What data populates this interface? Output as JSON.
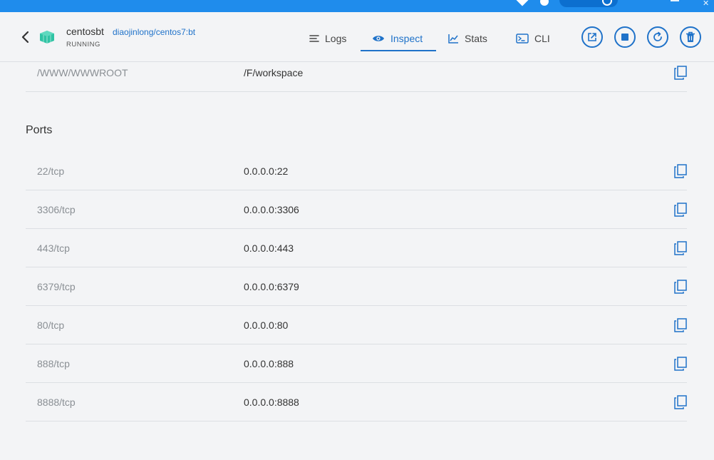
{
  "header": {
    "container_name": "centosbt",
    "image_name": "diaojinlong/centos7:bt",
    "status": "RUNNING"
  },
  "tabs": [
    {
      "label": "Logs",
      "icon": "lines-icon"
    },
    {
      "label": "Inspect",
      "icon": "eye-icon",
      "active": true
    },
    {
      "label": "Stats",
      "icon": "chart-icon"
    },
    {
      "label": "CLI",
      "icon": "terminal-icon"
    }
  ],
  "actions": [
    {
      "name": "open-in-browser",
      "icon": "external-link-icon"
    },
    {
      "name": "stop",
      "icon": "stop-icon"
    },
    {
      "name": "restart",
      "icon": "restart-icon"
    },
    {
      "name": "delete",
      "icon": "trash-icon"
    }
  ],
  "mounts": [
    {
      "key": "/WWW/WWWROOT",
      "value": "/F/workspace"
    }
  ],
  "ports_title": "Ports",
  "ports": [
    {
      "key": "22/tcp",
      "value": "0.0.0.0:22"
    },
    {
      "key": "3306/tcp",
      "value": "0.0.0.0:3306"
    },
    {
      "key": "443/tcp",
      "value": "0.0.0.0:443"
    },
    {
      "key": "6379/tcp",
      "value": "0.0.0.0:6379"
    },
    {
      "key": "80/tcp",
      "value": "0.0.0.0:80"
    },
    {
      "key": "888/tcp",
      "value": "0.0.0.0:888"
    },
    {
      "key": "8888/tcp",
      "value": "0.0.0.0:8888"
    }
  ],
  "colors": {
    "accent": "#1f72c9",
    "titlebar": "#1f8cec",
    "background": "#f3f4f6"
  }
}
